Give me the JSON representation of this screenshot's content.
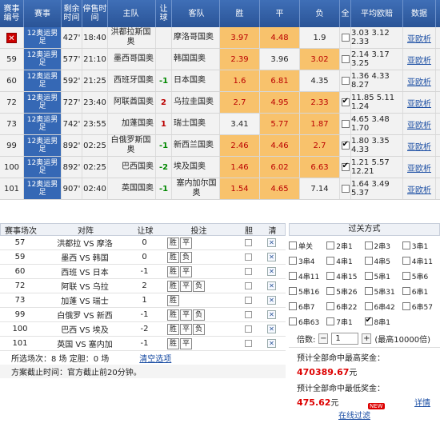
{
  "odds_table": {
    "headers": [
      "赛事编号",
      "赛事",
      "剩余时间",
      "停售时间",
      "主队",
      "让球",
      "客队",
      "胜",
      "平",
      "负",
      "全",
      "平均欧赔",
      "数据"
    ],
    "rows": [
      {
        "id": "",
        "league": "12奥运男足",
        "remain": "427'",
        "stop": "18:40",
        "home": "洪都拉斯国奥",
        "hc": "",
        "away": "摩洛哥国奥",
        "win": "3.97",
        "draw": "4.48",
        "lose": "1.9",
        "checked": false,
        "avg": "3.03 3.12 2.33",
        "link": "亚欧析",
        "cancel": true,
        "wc": "o-orange",
        "dc": "o-orange",
        "lc": "o-light"
      },
      {
        "id": "59",
        "league": "12奥运男足",
        "remain": "577'",
        "stop": "21:10",
        "home": "墨西哥国奥",
        "hc": "",
        "away": "韩国国奥",
        "win": "2.39",
        "draw": "3.96",
        "lose": "3.02",
        "checked": false,
        "avg": "2.14 3.17 3.25",
        "link": "亚欧析",
        "cancel": false,
        "wc": "o-orange",
        "dc": "o-light",
        "lc": "o-orange"
      },
      {
        "id": "60",
        "league": "12奥运男足",
        "remain": "592'",
        "stop": "21:25",
        "home": "西班牙国奥",
        "hc": "-1",
        "away": "日本国奥",
        "win": "1.6",
        "draw": "6.81",
        "lose": "4.35",
        "checked": false,
        "avg": "1.36 4.33 8.27",
        "link": "亚欧析",
        "cancel": false,
        "wc": "o-orange",
        "dc": "o-orange",
        "lc": "o-light"
      },
      {
        "id": "72",
        "league": "12奥运男足",
        "remain": "727'",
        "stop": "23:40",
        "home": "阿联酋国奥",
        "hc": "2",
        "away": "乌拉圭国奥",
        "win": "2.7",
        "draw": "4.95",
        "lose": "2.33",
        "checked": true,
        "avg": "11.85 5.11 1.24",
        "link": "亚欧析",
        "cancel": false,
        "wc": "o-orange",
        "dc": "o-orange",
        "lc": "o-orange"
      },
      {
        "id": "73",
        "league": "12奥运男足",
        "remain": "742'",
        "stop": "23:55",
        "home": "加蓬国奥",
        "hc": "1",
        "away": "瑞士国奥",
        "win": "3.41",
        "draw": "5.77",
        "lose": "1.87",
        "checked": false,
        "avg": "4.65 3.48 1.70",
        "link": "亚欧析",
        "cancel": false,
        "wc": "o-light",
        "dc": "o-orange",
        "lc": "o-orange"
      },
      {
        "id": "99",
        "league": "12奥运男足",
        "remain": "892'",
        "stop": "02:25",
        "home": "白俄罗斯国奥",
        "hc": "-1",
        "away": "新西兰国奥",
        "win": "2.46",
        "draw": "4.46",
        "lose": "2.7",
        "checked": true,
        "avg": "1.80 3.35 4.33",
        "link": "亚欧析",
        "cancel": false,
        "wc": "o-orange",
        "dc": "o-orange",
        "lc": "o-orange"
      },
      {
        "id": "100",
        "league": "12奥运男足",
        "remain": "892'",
        "stop": "02:25",
        "home": "巴西国奥",
        "hc": "-2",
        "away": "埃及国奥",
        "win": "1.46",
        "draw": "6.02",
        "lose": "6.63",
        "checked": true,
        "avg": "1.21 5.57 12.21",
        "link": "亚欧析",
        "cancel": false,
        "wc": "o-orange",
        "dc": "o-orange",
        "lc": "o-orange"
      },
      {
        "id": "101",
        "league": "12奥运男足",
        "remain": "907'",
        "stop": "02:40",
        "home": "英国国奥",
        "hc": "-1",
        "away": "塞内加尔国奥",
        "win": "1.54",
        "draw": "4.65",
        "lose": "7.14",
        "checked": false,
        "avg": "1.64 3.49 5.37",
        "link": "亚欧析",
        "cancel": false,
        "wc": "o-orange",
        "dc": "o-orange",
        "lc": "o-light"
      }
    ]
  },
  "bets_table": {
    "headers": [
      "赛事场次",
      "对阵",
      "让球",
      "投注",
      "胆",
      "清"
    ],
    "rows": [
      {
        "no": "57",
        "match": "洪都拉 VS 摩洛",
        "hc": "0",
        "picks": [
          "胜",
          "平"
        ]
      },
      {
        "no": "59",
        "match": "墨西 VS 韩国",
        "hc": "0",
        "picks": [
          "胜",
          "负"
        ]
      },
      {
        "no": "60",
        "match": "西班 VS 日本",
        "hc": "-1",
        "picks": [
          "胜",
          "平"
        ]
      },
      {
        "no": "72",
        "match": "阿联 VS 乌拉",
        "hc": "2",
        "picks": [
          "胜",
          "平",
          "负"
        ]
      },
      {
        "no": "73",
        "match": "加蓬 VS 瑞士",
        "hc": "1",
        "picks": [
          "胜"
        ]
      },
      {
        "no": "99",
        "match": "白俄罗 VS 新西",
        "hc": "-1",
        "picks": [
          "胜",
          "平",
          "负"
        ]
      },
      {
        "no": "100",
        "match": "巴西 VS 埃及",
        "hc": "-2",
        "picks": [
          "胜",
          "平",
          "负"
        ]
      },
      {
        "no": "101",
        "match": "英国 VS 塞内加",
        "hc": "-1",
        "picks": [
          "胜",
          "平"
        ]
      }
    ],
    "selected_summary": "所选场次：8 场 定胆：0 场",
    "clear_label": "清空选项",
    "deadline": "方案截止时间：官方截止前20分钟。"
  },
  "pass_panel": {
    "title": "过关方式",
    "options": [
      {
        "label": "单关",
        "checked": false
      },
      {
        "label": "2串1",
        "checked": false
      },
      {
        "label": "2串3",
        "checked": false
      },
      {
        "label": "3串1",
        "checked": false
      },
      {
        "label": "3串4",
        "checked": false
      },
      {
        "label": "4串1",
        "checked": false
      },
      {
        "label": "4串5",
        "checked": false
      },
      {
        "label": "4串11",
        "checked": false
      },
      {
        "label": "4串11",
        "checked": false
      },
      {
        "label": "4串15",
        "checked": false
      },
      {
        "label": "5串1",
        "checked": false
      },
      {
        "label": "5串6",
        "checked": false
      },
      {
        "label": "5串16",
        "checked": false
      },
      {
        "label": "5串26",
        "checked": false
      },
      {
        "label": "5串31",
        "checked": false
      },
      {
        "label": "6串1",
        "checked": false
      },
      {
        "label": "6串7",
        "checked": false
      },
      {
        "label": "6串22",
        "checked": false
      },
      {
        "label": "6串42",
        "checked": false
      },
      {
        "label": "6串57",
        "checked": false
      },
      {
        "label": "6串63",
        "checked": false
      },
      {
        "label": "7串1",
        "checked": false
      },
      {
        "label": "8串1",
        "checked": true
      }
    ],
    "multiplier_label": "倍数:",
    "multiplier_value": "1",
    "multiplier_max": "(最高10000倍)",
    "max_label": "预计全部命中最高奖金：",
    "max_value": "470389.67",
    "min_label": "预计全部命中最低奖金：",
    "min_value": "475.62",
    "unit": "元",
    "detail": "详情",
    "online_filter": "在线过滤",
    "new_tag": "NEW"
  }
}
